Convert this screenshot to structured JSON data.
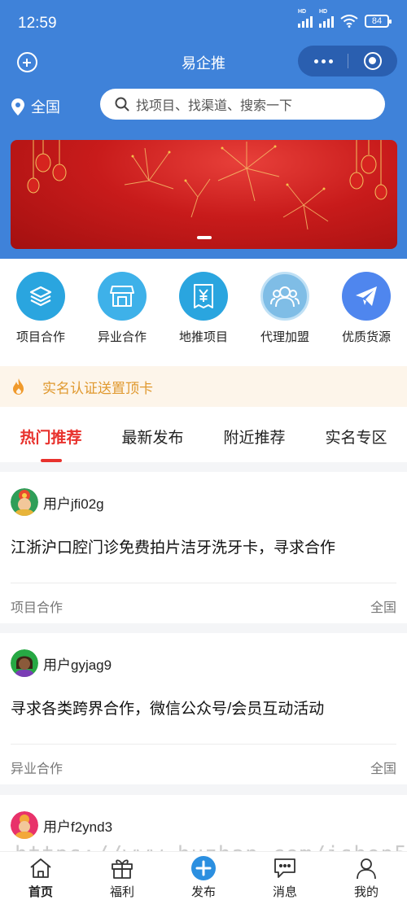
{
  "status_bar": {
    "time": "12:59",
    "battery": "84",
    "network_label": "HD"
  },
  "nav": {
    "title": "易企推"
  },
  "location": {
    "label": "全国"
  },
  "search": {
    "placeholder": "找项目、找渠道、搜索一下"
  },
  "categories": [
    {
      "label": "项目合作",
      "icon": "layers-icon",
      "color": "#2aa5df"
    },
    {
      "label": "异业合作",
      "icon": "store-icon",
      "color": "#3eb1e9"
    },
    {
      "label": "地推项目",
      "icon": "yen-ticket-icon",
      "color": "#2aa5df"
    },
    {
      "label": "代理加盟",
      "icon": "users-icon",
      "color": "#7fbde6"
    },
    {
      "label": "优质货源",
      "icon": "paper-plane-icon",
      "color": "#4f86ee"
    }
  ],
  "notice": {
    "text": "实名认证送置顶卡"
  },
  "tabs": [
    "热门推荐",
    "最新发布",
    "附近推荐",
    "实名专区"
  ],
  "posts": [
    {
      "user": "用户jfi02g",
      "title": "江浙沪口腔门诊免费拍片洁牙洗牙卡，寻求合作",
      "category": "项目合作",
      "area": "全国"
    },
    {
      "user": "用户gyjag9",
      "title": "寻求各类跨界合作，微信公众号/会员互动活动",
      "category": "异业合作",
      "area": "全国"
    },
    {
      "user": "用户f2ynd3"
    }
  ],
  "tabbar": [
    {
      "label": "首页",
      "icon": "home-icon"
    },
    {
      "label": "福利",
      "icon": "gift-icon"
    },
    {
      "label": "发布",
      "icon": "publish-plus-icon"
    },
    {
      "label": "消息",
      "icon": "message-icon"
    },
    {
      "label": "我的",
      "icon": "profile-icon"
    }
  ],
  "watermark": "https://www.huzhan.com/ishop5534",
  "colors": {
    "header": "#3f82d9",
    "accent_red": "#e8322d",
    "notice_text": "#e0992f"
  }
}
